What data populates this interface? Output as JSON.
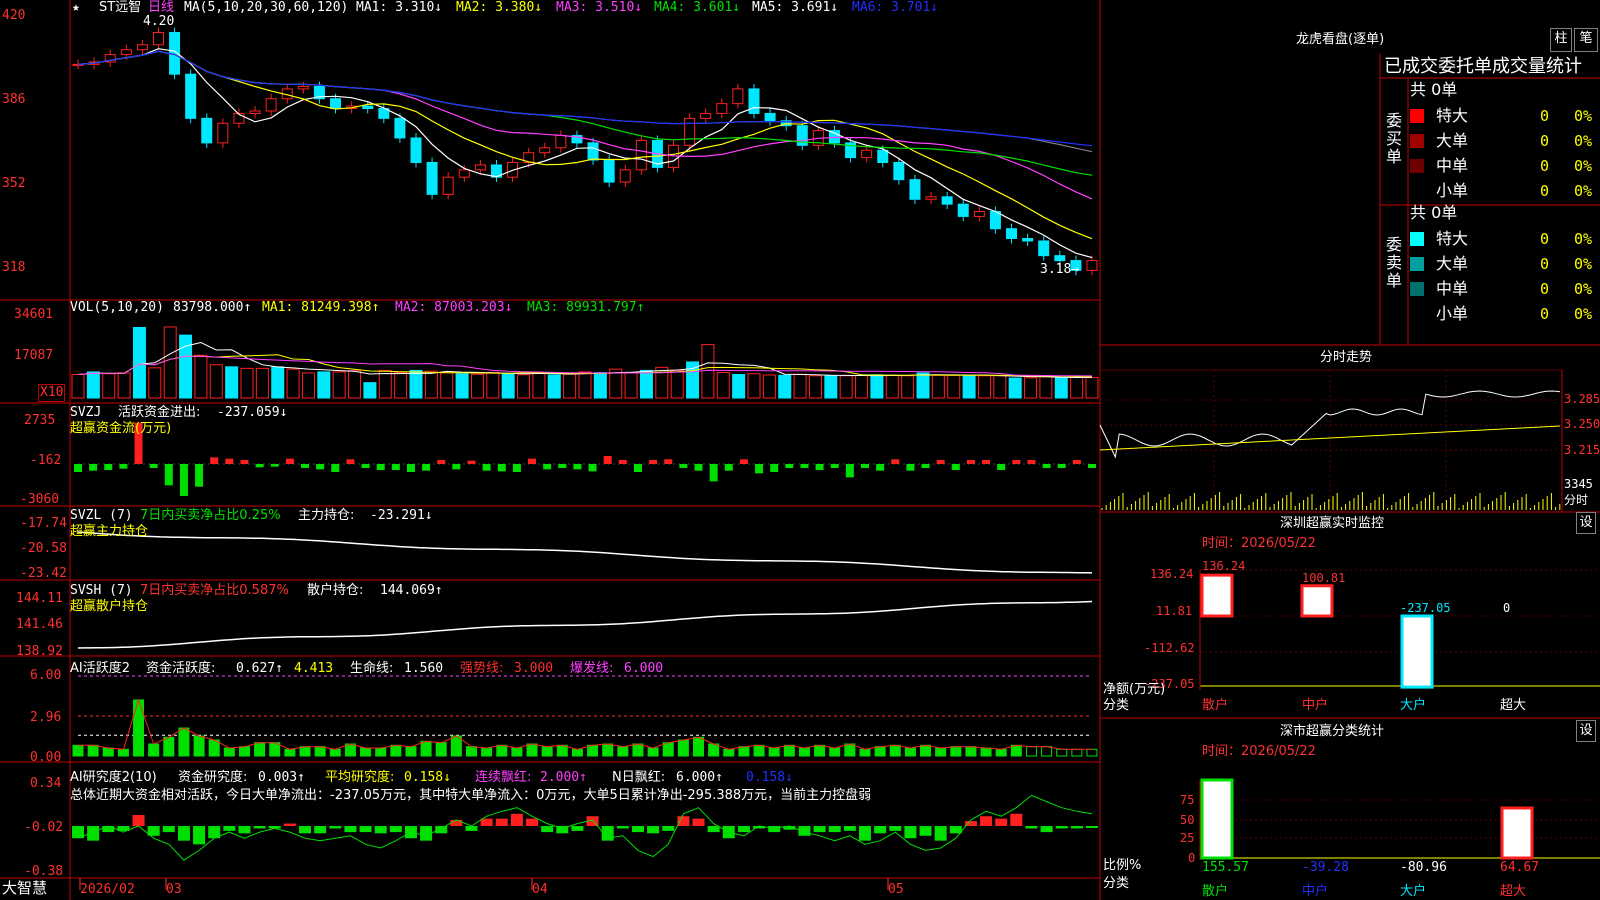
{
  "colors": {
    "up": "#ff2020",
    "down": "#00e8ff",
    "ma1": "#ffffff",
    "ma2": "#ffff00",
    "ma3": "#ff40ff",
    "ma4": "#00e000",
    "ma5": "#808080",
    "ma6": "#2030ff",
    "frame": "#c00000",
    "grid": "#5a0000"
  },
  "header": {
    "star": "★",
    "stock": "ST远智",
    "period": "日线",
    "ma_label": "MA(5,10,20,30,60,120)",
    "ma": [
      "MA1: 3.310↓",
      "MA2: 3.380↓",
      "MA3: 3.510↓",
      "MA4: 3.601↓",
      "MA5: 3.691↓",
      "MA6: 3.701↓"
    ]
  },
  "price": {
    "high_label": "4.20",
    "low_label": "3.18→",
    "ticks": [
      "420",
      "386",
      "352",
      "318"
    ],
    "closes": [
      4.02,
      4.03,
      4.06,
      4.08,
      4.1,
      4.15,
      3.98,
      3.8,
      3.7,
      3.78,
      3.82,
      3.83,
      3.88,
      3.92,
      3.93,
      3.88,
      3.84,
      3.85,
      3.84,
      3.8,
      3.72,
      3.62,
      3.49,
      3.56,
      3.59,
      3.61,
      3.56,
      3.62,
      3.66,
      3.68,
      3.73,
      3.7,
      3.63,
      3.54,
      3.59,
      3.71,
      3.6,
      3.69,
      3.8,
      3.82,
      3.86,
      3.92,
      3.82,
      3.79,
      3.77,
      3.69,
      3.75,
      3.7,
      3.64,
      3.67,
      3.62,
      3.55,
      3.47,
      3.48,
      3.45,
      3.4,
      3.42,
      3.35,
      3.31,
      3.3,
      3.24,
      3.22,
      3.18,
      3.22
    ]
  },
  "vol": {
    "label": "VOL(5,10,20)",
    "value": "83798.000↑",
    "ma": [
      "MA1: 81249.398↑",
      "MA2: 87003.203↓",
      "MA3: 89931.797↑"
    ],
    "ticks": [
      "34601",
      "17087"
    ],
    "unit": "X10",
    "values": [
      9200,
      10200,
      9500,
      9800,
      27600,
      11800,
      27800,
      24600,
      16700,
      13000,
      12200,
      11600,
      11600,
      12200,
      11300,
      9800,
      10200,
      10200,
      10700,
      6000,
      10800,
      10000,
      10800,
      10500,
      9900,
      9500,
      9300,
      10000,
      9600,
      9100,
      10000,
      9000,
      9300,
      10200,
      9900,
      11300,
      9800,
      10800,
      12000,
      10800,
      14100,
      20900,
      10000,
      9200,
      9500,
      9000,
      8900,
      9300,
      8700,
      8600,
      8700,
      8800,
      9100,
      8900,
      8700,
      9800,
      8900,
      8900,
      8700,
      8700,
      8700,
      7800,
      7900,
      8300,
      8000,
      8100,
      8000
    ]
  },
  "svzj": {
    "label": "SVZJ",
    "value_label": "活跃资金进出:",
    "value": "-237.059↓",
    "sub": "超赢资金流(万元)",
    "ticks": [
      "2735",
      "-162",
      "-3060"
    ],
    "values": [
      -600,
      -500,
      -450,
      -350,
      3100,
      -300,
      -1600,
      -2400,
      -1700,
      500,
      400,
      300,
      -250,
      -200,
      400,
      -300,
      -400,
      -600,
      350,
      -300,
      -450,
      -450,
      -600,
      -500,
      300,
      -400,
      250,
      -500,
      -550,
      -600,
      400,
      -400,
      -300,
      -400,
      -550,
      600,
      300,
      -600,
      300,
      350,
      -300,
      -500,
      -1300,
      -500,
      350,
      -700,
      -600,
      -300,
      -300,
      -450,
      -300,
      -1000,
      -300,
      -500,
      350,
      -500,
      -300,
      300,
      -450,
      300,
      300,
      -450,
      300,
      300,
      -300,
      -300,
      300,
      -300
    ]
  },
  "svzl": {
    "label": "SVZL (7)",
    "pct_label": "7日内买卖净占比0.25%",
    "main_label": "主力持仓:",
    "main_value": "-23.291↓",
    "sub": "超赢主力持仓",
    "ticks": [
      "-17.74",
      "-20.58",
      "-23.42"
    ]
  },
  "svsh": {
    "label": "SVSH (7)",
    "pct_label": "7日内买卖净占比0.587%",
    "retail_label": "散户持仓:",
    "retail_value": "144.069↑",
    "sub": "超赢散户持仓",
    "ticks": [
      "144.11",
      "141.46",
      "138.92"
    ]
  },
  "ai1": {
    "label": "AI活跃度2",
    "t1": "资金活跃度:",
    "v1": "0.627↑",
    "v2": "4.413",
    "t3": "生命线:",
    "v3": "1.560",
    "t4": "强势线:",
    "v4": "3.000",
    "t5": "爆发线:",
    "v5": "6.000",
    "ticks": [
      "6.00",
      "2.96",
      "0.00"
    ],
    "values": [
      0.8,
      0.8,
      0.6,
      0.5,
      4.2,
      0.9,
      1.4,
      2.1,
      1.5,
      1.2,
      0.6,
      0.7,
      1.0,
      1.0,
      0.5,
      0.7,
      0.7,
      0.5,
      0.9,
      0.6,
      0.6,
      0.8,
      0.7,
      1.1,
      1.0,
      1.5,
      0.7,
      0.6,
      0.8,
      0.6,
      0.9,
      0.7,
      0.8,
      0.5,
      0.8,
      0.9,
      0.7,
      0.9,
      0.6,
      1.0,
      1.2,
      1.4,
      0.9,
      0.5,
      0.7,
      0.8,
      0.6,
      0.8,
      0.6,
      0.8,
      0.6,
      0.9,
      0.5,
      0.7,
      0.8,
      0.6,
      0.8,
      0.6,
      0.7,
      0.7,
      0.6,
      0.5,
      0.8,
      0.7,
      0.7,
      0.5,
      0.5,
      0.5
    ]
  },
  "ai2": {
    "label": "AI研究度2(10)",
    "t1": "资金研究度:",
    "v1": "0.003↑",
    "t2": "平均研究度:",
    "v2": "0.158↓",
    "t3": "连续飘红:",
    "v3": "2.000↑",
    "t4": "N日飘红:",
    "v4": "6.000↑",
    "v5": "0.158↓",
    "note": "总体近期大资金相对活跃，今日大单净流出：-237.05万元，其中特大单净流入：0万元，大单5日累计净出-295.388万元，当前主力控盘弱",
    "ticks": [
      "0.34",
      "-0.02",
      "-0.38"
    ],
    "values": [
      -0.1,
      -0.12,
      -0.05,
      -0.04,
      0.09,
      -0.08,
      -0.05,
      -0.12,
      -0.15,
      -0.1,
      -0.04,
      -0.06,
      -0.02,
      -0.02,
      0.02,
      -0.06,
      -0.06,
      -0.02,
      -0.05,
      -0.05,
      -0.06,
      -0.05,
      -0.1,
      -0.12,
      -0.06,
      0.05,
      -0.04,
      0.06,
      0.06,
      0.1,
      0.06,
      -0.05,
      -0.06,
      -0.04,
      0.08,
      -0.12,
      -0.02,
      -0.05,
      -0.06,
      -0.04,
      0.08,
      0.06,
      -0.05,
      -0.1,
      -0.05,
      -0.02,
      -0.05,
      -0.03,
      -0.08,
      -0.05,
      -0.05,
      -0.04,
      -0.12,
      -0.06,
      -0.04,
      -0.1,
      -0.08,
      -0.12,
      -0.06,
      0.04,
      0.08,
      0.06,
      0.1,
      -0.02,
      -0.05,
      -0.02,
      -0.02,
      0.0
    ],
    "line": [
      -0.1,
      -0.05,
      0.0,
      -0.05,
      0.0,
      -0.1,
      -0.15,
      -0.28,
      -0.2,
      -0.1,
      -0.05,
      -0.1,
      -0.05,
      -0.02,
      -0.05,
      -0.1,
      -0.12,
      -0.1,
      -0.08,
      -0.15,
      -0.18,
      -0.12,
      -0.05,
      -0.08,
      -0.02,
      0.05,
      0.0,
      0.08,
      0.12,
      0.15,
      0.08,
      0.02,
      -0.02,
      0.02,
      0.05,
      -0.1,
      -0.08,
      -0.2,
      -0.25,
      -0.15,
      0.1,
      0.15,
      0.02,
      -0.05,
      -0.08,
      0.0,
      -0.02,
      0.0,
      -0.05,
      -0.08,
      -0.12,
      -0.08,
      -0.15,
      -0.12,
      -0.05,
      -0.15,
      -0.2,
      -0.18,
      -0.1,
      0.05,
      0.12,
      0.08,
      0.15,
      0.25,
      0.2,
      0.15,
      0.12,
      0.1
    ]
  },
  "xaxis": {
    "labels": [
      "2026/02",
      "03",
      "04",
      "05"
    ]
  },
  "brand": "大智慧",
  "right": {
    "title": "龙虎看盘(逐单)",
    "btn_bar": "柱",
    "btn_pen": "笔",
    "table_title": "已成交委托单成交量统计",
    "buy": {
      "side": [
        "委",
        "买",
        "单"
      ],
      "total": "共 0单",
      "rows": [
        {
          "name": "特大",
          "v": "0",
          "p": "0%",
          "c": "#ff0000"
        },
        {
          "name": "大单",
          "v": "0",
          "p": "0%",
          "c": "#a00000"
        },
        {
          "name": "中单",
          "v": "0",
          "p": "0%",
          "c": "#700000"
        },
        {
          "name": "小单",
          "v": "0",
          "p": "0%",
          "c": "#000000"
        }
      ]
    },
    "sell": {
      "side": [
        "委",
        "卖",
        "单"
      ],
      "total": "共 0单",
      "rows": [
        {
          "name": "特大",
          "v": "0",
          "p": "0%",
          "c": "#00ffff"
        },
        {
          "name": "大单",
          "v": "0",
          "p": "0%",
          "c": "#00a0a0"
        },
        {
          "name": "中单",
          "v": "0",
          "p": "0%",
          "c": "#007070"
        },
        {
          "name": "小单",
          "v": "0",
          "p": "0%",
          "c": "#000000"
        }
      ]
    },
    "intraday": {
      "title": "分时走势",
      "ticks": [
        "3.285",
        "3.250",
        "3.215"
      ],
      "vol_tick": "3345",
      "vol_label": "分时"
    },
    "sz_monitor": {
      "title": "深圳超赢实时监控",
      "btn": "设",
      "time": "时间：2026/05/22",
      "ticks": [
        "136.24",
        "11.81",
        "-112.62",
        "-237.05"
      ],
      "bars": [
        {
          "label": "136.24",
          "v": 136.24
        },
        {
          "label": "100.81",
          "v": 100.81
        },
        {
          "label": "-237.05",
          "v": -237.05
        },
        {
          "label": "0",
          "v": 0
        }
      ],
      "unit": "净额(万元)",
      "cat_label": "分类",
      "cats": [
        "散户",
        "中户",
        "大户",
        "超大"
      ]
    },
    "sz_stats": {
      "title": "深市超赢分类统计",
      "btn": "设",
      "time": "时间：2026/05/22",
      "ticks": [
        "75",
        "50",
        "25",
        "0"
      ],
      "ratio_label": "比例%",
      "cat_label": "分类",
      "vals": [
        "155.57",
        "-39.28",
        "-80.96",
        "64.67"
      ],
      "cats": [
        "散户",
        "中户",
        "大户",
        "超大"
      ]
    }
  }
}
